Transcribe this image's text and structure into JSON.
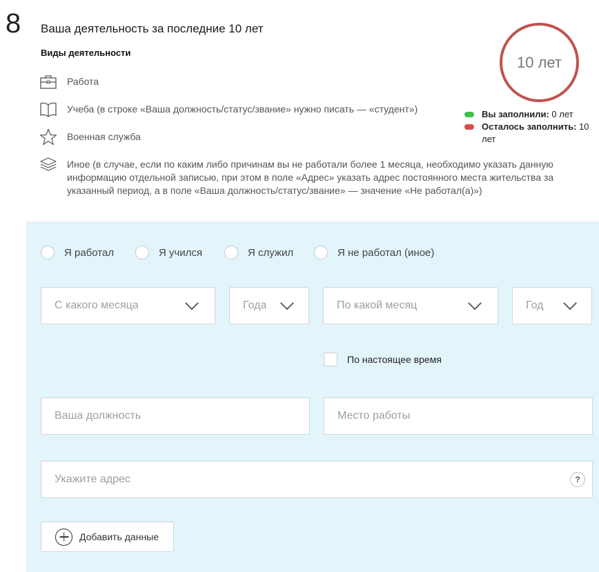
{
  "step": {
    "number": "8",
    "title": "Ваша деятельность за последние 10 лет"
  },
  "kinds": {
    "heading": "Виды деятельности",
    "items": [
      {
        "icon": "briefcase-icon",
        "label": "Работа"
      },
      {
        "icon": "book-icon",
        "label": "Учеба (в строке «Ваша должность/статус/звание» нужно писать — «студент»)"
      },
      {
        "icon": "star-icon",
        "label": "Военная служба"
      },
      {
        "icon": "layers-icon",
        "label": "Иное (в случае, если по каким либо причинам вы не работали более 1 месяца, необходимо указать данную информацию отдельной записью, при этом в поле «Адрес» указать адрес постоянного места жительства за указанный период, а в поле «Ваша должность/статус/звание» — значение «Не работал(а)»)"
      }
    ]
  },
  "progress": {
    "circle_label": "10 лет",
    "filled_label": "Вы заполнили:",
    "filled_value": " 0 лет",
    "remaining_label": "Осталось заполнить:",
    "remaining_value": " 10 лет",
    "colors": {
      "filled": "#3cc24a",
      "remaining": "#dc4b4b",
      "circle": "#c0534e"
    }
  },
  "form": {
    "radios": [
      "Я работал",
      "Я учился",
      "Я служил",
      "Я не работал (иное)"
    ],
    "selects": {
      "from_month": "С какого месяца",
      "from_year": "Года",
      "to_month": "По какой месяц",
      "to_year": "Год"
    },
    "checkbox_label": "По настоящее время",
    "position_placeholder": "Ваша должность",
    "workplace_placeholder": "Место работы",
    "address_placeholder": "Укажите адрес",
    "help_label": "?",
    "add_label": "Добавить данные",
    "background": "#e3f4fb"
  }
}
